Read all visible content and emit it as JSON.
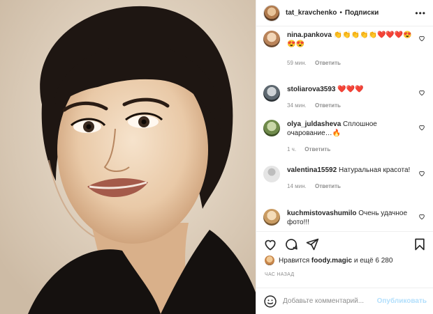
{
  "header": {
    "username": "tat_kravchenko",
    "separator": "•",
    "follow_label": "Подписки",
    "more_icon": "more-icon"
  },
  "comments": [
    {
      "user": "nina.pankova",
      "text": "👏👏👏👏👏❤️❤️❤️😍😍😍",
      "time": "59 мин.",
      "reply": "Ответить"
    },
    {
      "user": "stoliarova3593",
      "text": "❤️❤️❤️",
      "time": "34 мин.",
      "reply": "Ответить"
    },
    {
      "user": "olya_juldasheva",
      "text": "Сплошное очарование…🔥",
      "time": "1 ч.",
      "reply": "Ответить"
    },
    {
      "user": "valentina15592",
      "text": "Натуральная красота!",
      "time": "14 мин.",
      "reply": "Ответить"
    },
    {
      "user": "kuchmistovashumilo",
      "text": "Очень удачное фото!!!",
      "time": "",
      "reply": ""
    }
  ],
  "likes": {
    "prefix": "Нравится",
    "user": "foody.magic",
    "suffix": "и ещё 6 280"
  },
  "time_ago": "ЧАС НАЗАД",
  "add_comment": {
    "placeholder": "Добавьте комментарий...",
    "post_label": "Опубликовать"
  },
  "colors": {
    "accent": "#0095f6",
    "accent_disabled": "#b2dffc",
    "heart_red": "#e5202a",
    "meta_gray": "#8e8e8e"
  }
}
